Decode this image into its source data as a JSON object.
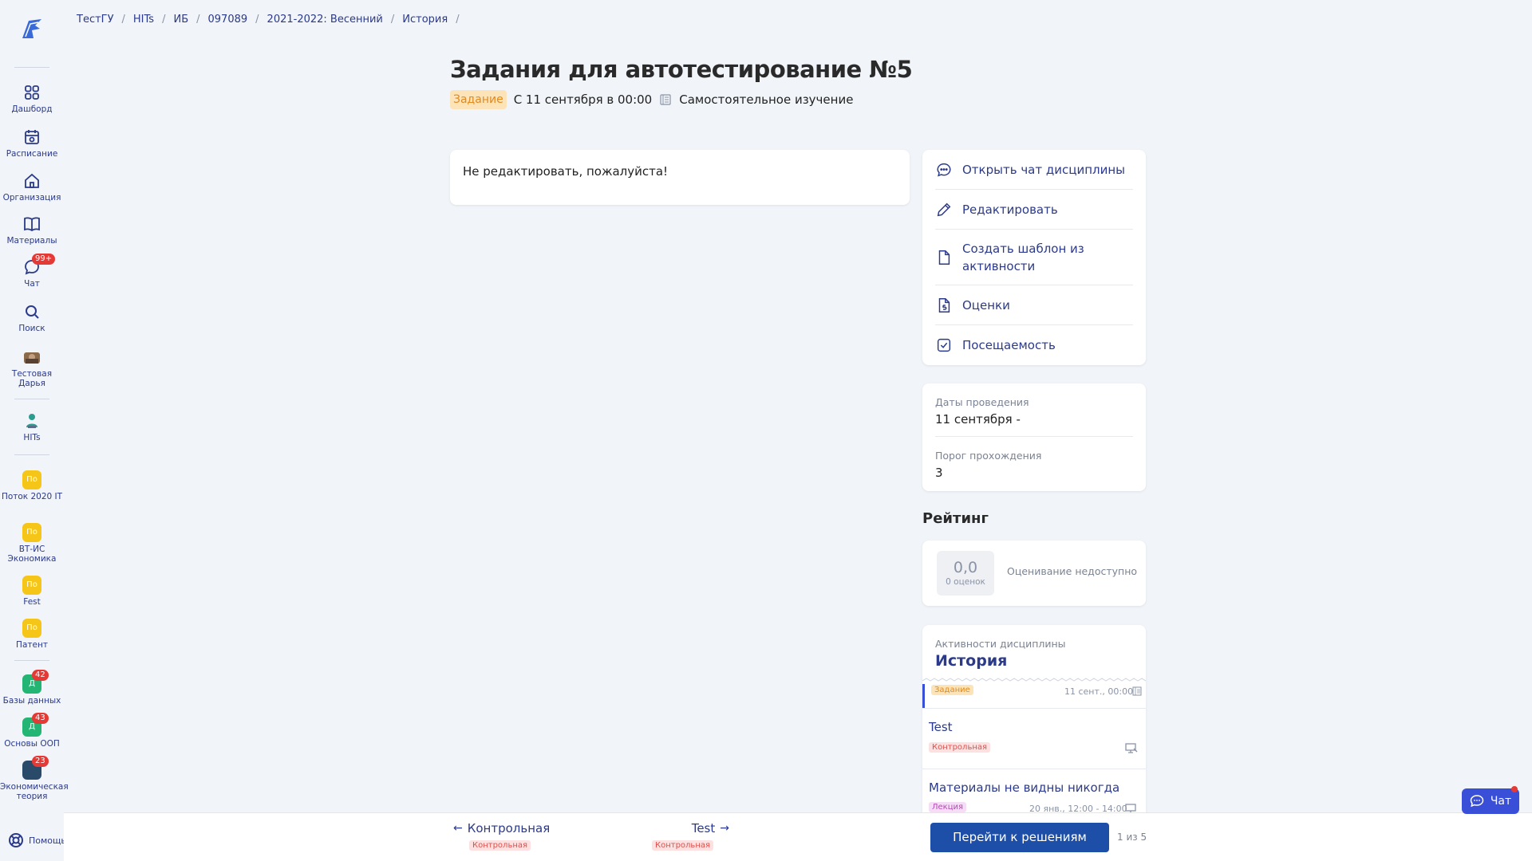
{
  "breadcrumb": [
    "ТестГУ",
    "HITs",
    "ИБ",
    "097089",
    "2021-2022: Весенний",
    "История"
  ],
  "page": {
    "title": "Задания для автотестирование №5",
    "type_tag": "Задание",
    "date": "С 11 сентября в 00:00",
    "mode": "Самостоятельное изучение",
    "content": "Не редактировать, пожалуйста!"
  },
  "sidebar": {
    "dashboard": "Дашборд",
    "schedule": "Расписание",
    "organization": "Организация",
    "materials": "Материалы",
    "chat": "Чат",
    "chat_badge": "99+",
    "search": "Поиск",
    "user": "Тестовая Дарья",
    "hits": "HITs",
    "courses": [
      {
        "label": "Поток 2020 IT",
        "abbr": "По",
        "color": "#f5c518"
      },
      {
        "label": "ВТ-ИС Экономика",
        "abbr": "По",
        "color": "#f5c518"
      },
      {
        "label": "Fest",
        "abbr": "По",
        "color": "#f5c518"
      },
      {
        "label": "Патент",
        "abbr": "По",
        "color": "#f5c518"
      },
      {
        "label": "Базы данных",
        "abbr": "Д",
        "color": "#22b573",
        "badge": "42"
      },
      {
        "label": "Основы ООП",
        "abbr": "Д",
        "color": "#22b573",
        "badge": "43"
      },
      {
        "label": "Экономическая теория",
        "abbr": "",
        "color": "#2a4a6a",
        "badge": "23"
      }
    ],
    "help": "Помощь"
  },
  "actions": [
    {
      "label": "Открыть чат дисциплины",
      "icon": "chat-bubble-icon"
    },
    {
      "label": "Редактировать",
      "icon": "pencil-icon"
    },
    {
      "label": "Создать шаблон из активности",
      "icon": "document-icon"
    },
    {
      "label": "Оценки",
      "icon": "grade-document-icon"
    },
    {
      "label": "Посещаемость",
      "icon": "checkbox-icon"
    }
  ],
  "info": {
    "dates_label": "Даты проведения",
    "dates_value": "11 сентября -",
    "threshold_label": "Порог прохождения",
    "threshold_value": "3"
  },
  "rating": {
    "title": "Рейтинг",
    "score": "0,0",
    "count": "0 оценок",
    "status": "Оценивание недоступно"
  },
  "discipline": {
    "label": "Активности дисциплины",
    "title": "История",
    "current": {
      "tag": "Задание",
      "date": "11 сент., 00:00"
    },
    "items": [
      {
        "title": "Test",
        "tag": "Контрольная"
      },
      {
        "title": "Материалы не видны никогда",
        "tag": "Лекция",
        "date": "20 янв., 12:00 - 14:00"
      }
    ]
  },
  "bottom": {
    "prev_title": "Контрольная",
    "prev_tag": "Контрольная",
    "next_title": "Test",
    "next_tag": "Контрольная",
    "go_button": "Перейти к решениям",
    "pager": "1 из 5"
  },
  "chat_button": "Чат",
  "colors": {
    "accent": "#2b3a8a",
    "primary_button": "#1e4fa8",
    "task_tag": "#fde3b8"
  }
}
